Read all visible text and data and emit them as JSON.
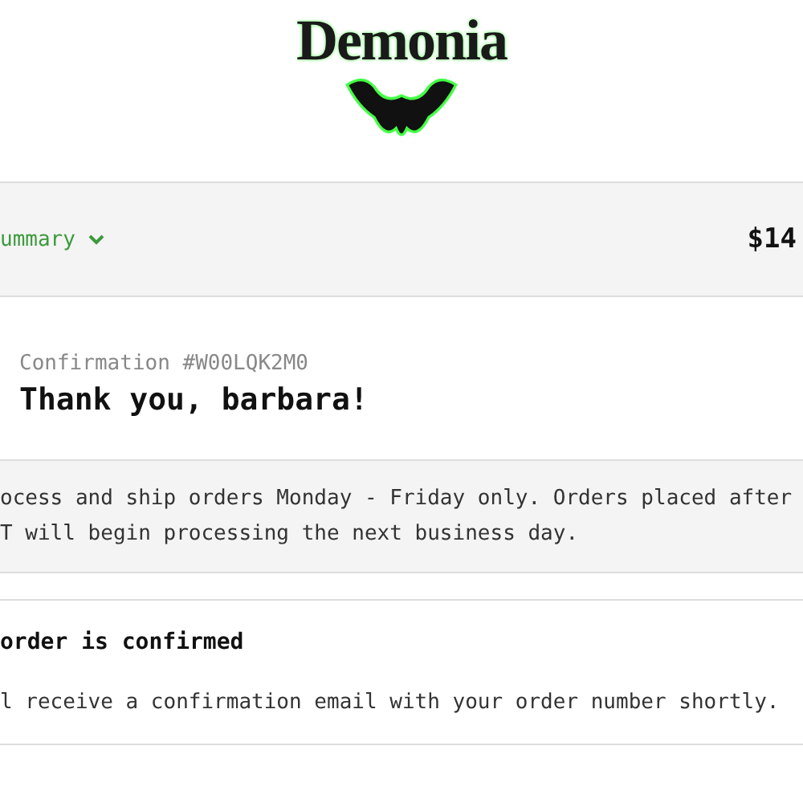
{
  "logo": {
    "text": "Demonia"
  },
  "summary_bar": {
    "toggle": "ummary",
    "total": "$14"
  },
  "confirmation": {
    "number": "Confirmation #W00LQK2M0",
    "heading": "Thank you, barbara!"
  },
  "notice": {
    "lines": [
      "ocess and ship orders Monday - Friday only. Orders placed after",
      "T will begin processing the next business day."
    ]
  },
  "status_card": {
    "title": "order is confirmed",
    "text": "l receive a confirmation email with your order number shortly."
  }
}
